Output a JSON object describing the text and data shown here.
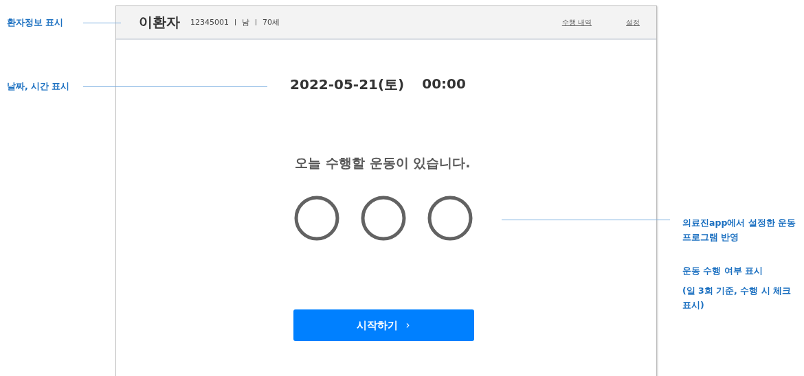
{
  "left_notes": [
    {
      "text": "환자정보 표시"
    },
    {
      "text": "날짜, 시간 표시"
    }
  ],
  "screen": {
    "header": {
      "name": "이환자",
      "info": [
        "12345001",
        "남",
        "70세"
      ],
      "links": [
        "수행 내역",
        "설정"
      ]
    },
    "date": "2022-05-21(토)",
    "time": "00:00",
    "message": "오늘 수행할 운동이 있습니다.",
    "exercises": [
      {
        "checked": false
      },
      {
        "checked": false
      },
      {
        "checked": false
      }
    ],
    "start_button": {
      "label": "시작하기",
      "arrow": "›"
    }
  },
  "right_notes": [
    {
      "text": "의료진app에서 설정한 운동 프로그램 반영"
    },
    {
      "text": "운동 수행 여부 표시"
    },
    {
      "text": "(일 3회 기준, 수행 시 체크 표시)"
    }
  ]
}
